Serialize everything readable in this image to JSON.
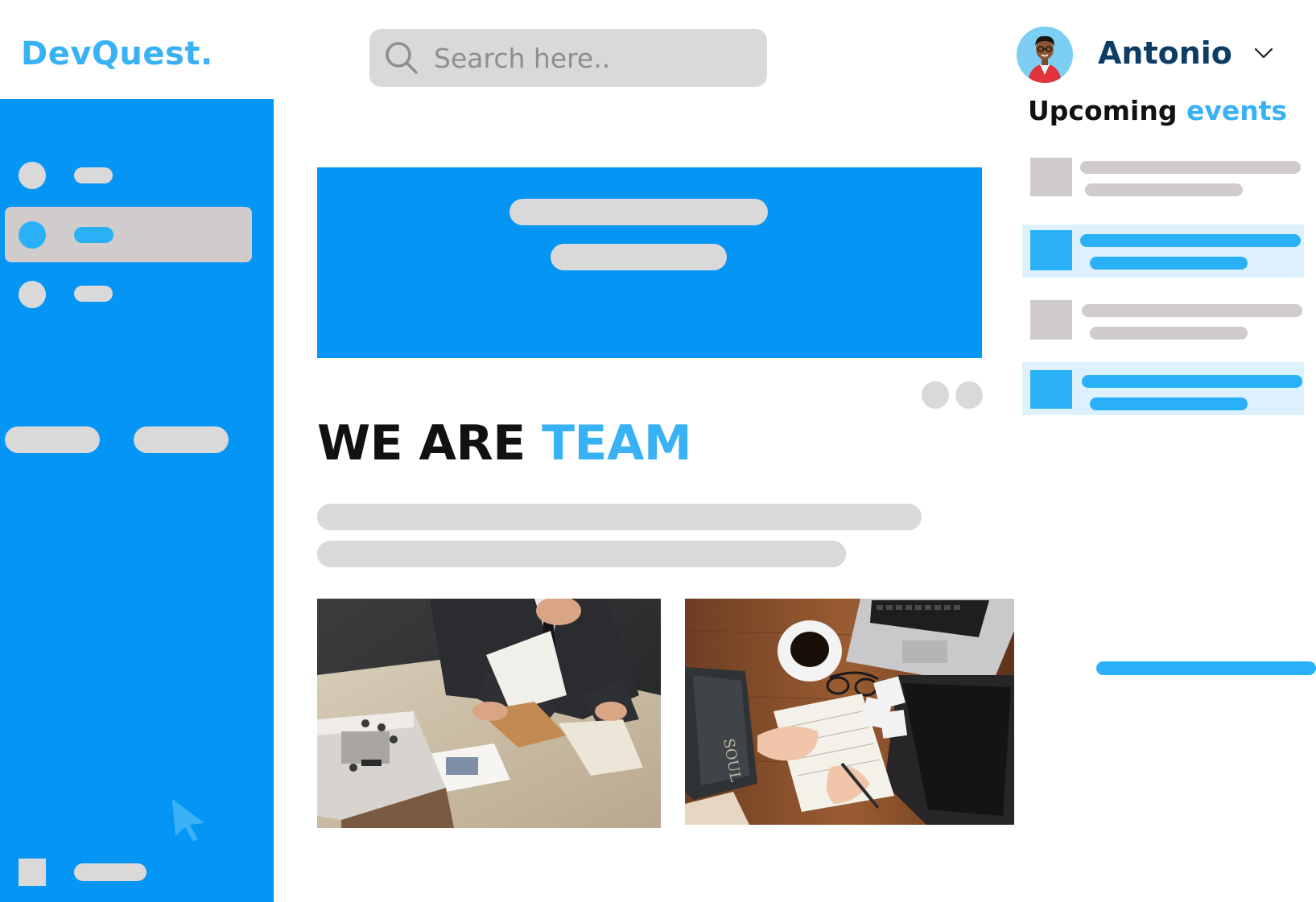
{
  "brand": {
    "name": "DevQuest."
  },
  "search": {
    "placeholder": "Search here.."
  },
  "user": {
    "name": "Antonio"
  },
  "events": {
    "title_main": "Upcoming",
    "title_accent": "events"
  },
  "main": {
    "heading_main": "WE ARE",
    "heading_accent": "TEAM"
  },
  "colors": {
    "primary": "#0595f5",
    "accent": "#39b1f5",
    "placeholder_gray": "#d0cccc",
    "highlight_bg": "#ddf1fc",
    "username": "#0d3c64"
  },
  "icons": [
    "search-icon",
    "avatar",
    "chevron-down-icon",
    "cursor-arrow-icon"
  ]
}
